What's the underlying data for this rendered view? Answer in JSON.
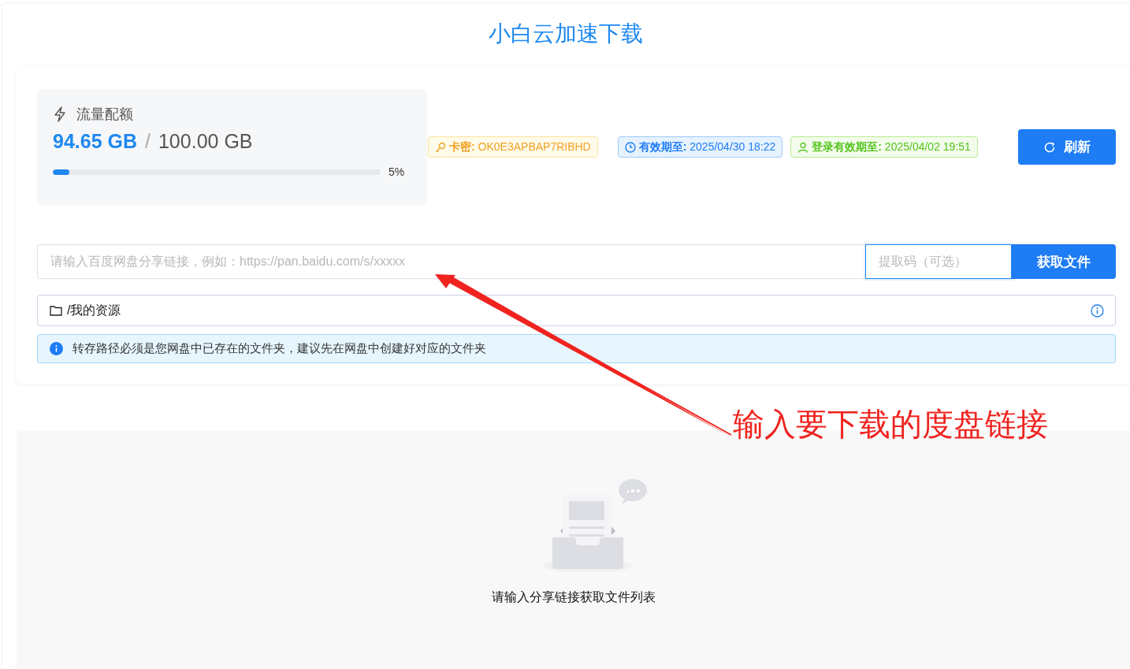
{
  "title": "小白云加速下载",
  "quota": {
    "label": "流量配额",
    "used": "94.65 GB",
    "separator": "/",
    "total": "100.00 GB",
    "level": 0.05,
    "percent": "5%"
  },
  "tags": [
    {
      "kind": "key",
      "text": "**卡密:** OK0E3APBAP7RIBHD"
    },
    {
      "kind": "expiry",
      "text": "**有效期至:** 2025/04/30 18:22"
    },
    {
      "kind": "login",
      "text": "**登录有效期至:** 2025/04/02 19:51"
    }
  ],
  "refresh_button": "刷新",
  "link_input": {
    "placeholder": "请输入百度网盘分享链接，例如：https://pan.baidu.com/s/xxxxx"
  },
  "code_input": {
    "placeholder": "提取码（可选）",
    "focused": true
  },
  "fetch_button": "获取文件",
  "save_path": {
    "value": "/我的资源"
  },
  "alert": "转存路径必须是您网盘中已存在的文件夹，建议先在网盘中创建好对应的文件夹",
  "empty_state": "请输入分享链接获取文件列表",
  "annotation": "输入要下载的度盘链接"
}
